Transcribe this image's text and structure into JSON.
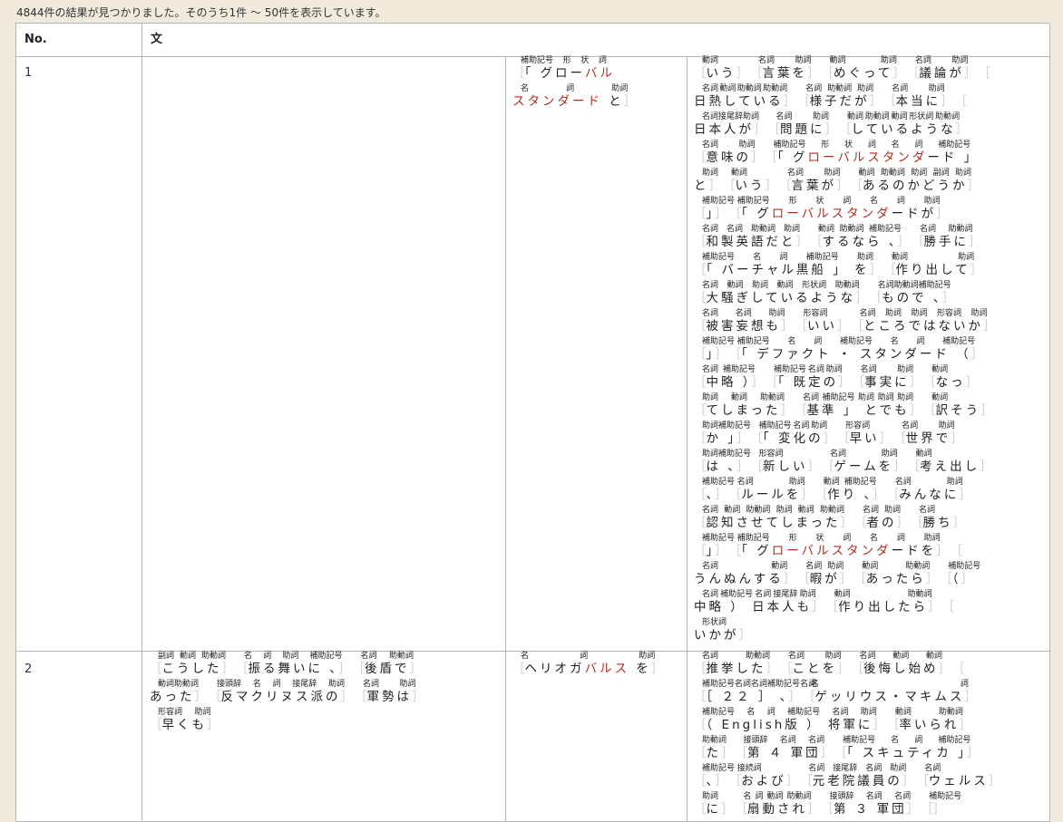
{
  "summary": "4844件の結果が見つかりました。そのうち1件 〜 50件を表示しています。",
  "table": {
    "headers": {
      "no": "No.",
      "sentence": "文"
    },
    "rows": [
      {
        "no": "1",
        "left": [],
        "keyword": [
          [
            {
              "pos": "補助記号 形 状 詞",
              "parts": [
                {
                  "t": "「 グロー"
                },
                {
                  "t": "バル",
                  "kw": true
                }
              ],
              "open": true,
              "close": false
            }
          ],
          [
            {
              "pos": "名 詞 助詞",
              "parts": [
                {
                  "t": "スタンダード",
                  "kw": true
                },
                {
                  "t": " と"
                }
              ],
              "open": false,
              "close": true
            }
          ]
        ],
        "right": [
          [
            {
              "pos": "動詞",
              "text": "いう"
            },
            {
              "pos": "名詞 助詞",
              "text": "言葉を"
            },
            {
              "pos": "動詞 助詞",
              "text": "めぐって"
            },
            {
              "pos": "名詞 助詞",
              "text": "議論が"
            },
            {
              "pos": "",
              "text": "",
              "open": true,
              "close": false
            }
          ],
          [
            {
              "pos": "名詞 動詞 助動詞 助動詞",
              "text": "日熱している",
              "open": false
            },
            {
              "pos": "名詞 助動詞 助詞",
              "text": "様子だが"
            },
            {
              "pos": "名詞 助詞",
              "text": "本当に"
            },
            {
              "pos": "",
              "text": "",
              "open": true,
              "close": false
            }
          ],
          [
            {
              "pos": "名詞 接尾辞 助詞",
              "text": "日本人が",
              "open": false
            },
            {
              "pos": "名詞 助詞",
              "text": "問題に"
            },
            {
              "pos": "動詞 助動詞 動詞 形状詞 助動詞",
              "text": "しているような"
            }
          ],
          [
            {
              "pos": "名詞 助詞",
              "text": "意味の"
            },
            {
              "pos": "補助記号 形 状 詞 名 詞 補助記号",
              "text": "「 グローバルスタンダード 」",
              "kwrange": [
                3,
                11
              ],
              "close": false
            }
          ],
          [
            {
              "pos": "助詞",
              "text": "と",
              "open": false
            },
            {
              "pos": "動詞",
              "text": "いう"
            },
            {
              "pos": "名詞 助詞",
              "text": "言葉が"
            },
            {
              "pos": "動詞 助動詞 助詞 副詞 助詞",
              "text": "あるのかどうか"
            }
          ],
          [
            {
              "pos": "補助記号",
              "text": "」"
            },
            {
              "pos": "補助記号 形 状 詞 名 詞 助詞",
              "text": "「 グローバルスタンダードが",
              "kwrange": [
                3,
                11
              ],
              "close": true
            }
          ],
          [
            {
              "pos": "名詞 名詞 助動詞 助詞",
              "text": "和製英語だと"
            },
            {
              "pos": "動詞 助動詞 補助記号",
              "text": "するなら 、"
            },
            {
              "pos": "名詞 助動詞",
              "text": "勝手に"
            }
          ],
          [
            {
              "pos": "補助記号 名 詞 補助記号 助詞",
              "text": "「 バーチャル黒船 」 を"
            },
            {
              "pos": "動詞 助詞",
              "text": "作り出して"
            }
          ],
          [
            {
              "pos": "名詞 動詞 助詞 動詞 形状詞 助動詞",
              "text": "大騒ぎしているような"
            },
            {
              "pos": "名詞 助動詞 補助記号",
              "text": "もので 、"
            }
          ],
          [
            {
              "pos": "名詞 名詞 助詞",
              "text": "被害妄想も"
            },
            {
              "pos": "形容詞",
              "text": "いい"
            },
            {
              "pos": "名詞 助詞 助詞 形容詞 助詞",
              "text": "ところではないか"
            }
          ],
          [
            {
              "pos": "補助記号",
              "text": "」"
            },
            {
              "pos": "補助記号 名 詞 補助記号 名 詞 補助記号",
              "text": "「 デファクト ・ スタンダード （"
            }
          ],
          [
            {
              "pos": "名詞 補助記号",
              "text": "中略 ）"
            },
            {
              "pos": "補助記号 名詞 助詞",
              "text": "「 既定の"
            },
            {
              "pos": "名詞 助詞",
              "text": "事実に"
            },
            {
              "pos": "動詞",
              "text": "なっ"
            }
          ],
          [
            {
              "pos": "助詞 動詞 助動詞",
              "text": "てしまった"
            },
            {
              "pos": "名詞 補助記号 助詞 助詞 助詞",
              "text": "基準 」 とでも"
            },
            {
              "pos": "動詞",
              "text": "訳そう"
            }
          ],
          [
            {
              "pos": "助詞 補助記号",
              "text": "か 」"
            },
            {
              "pos": "補助記号 名詞 助詞",
              "text": "「 変化の"
            },
            {
              "pos": "形容詞",
              "text": "早い"
            },
            {
              "pos": "名詞 助詞",
              "text": "世界で"
            }
          ],
          [
            {
              "pos": "助詞 補助記号",
              "text": "は 、"
            },
            {
              "pos": "形容詞",
              "text": "新しい"
            },
            {
              "pos": "名詞 助詞",
              "text": "ゲームを"
            },
            {
              "pos": "動詞",
              "text": "考え出し"
            }
          ],
          [
            {
              "pos": "補助記号",
              "text": "、"
            },
            {
              "pos": "名詞 助詞",
              "text": "ルールを"
            },
            {
              "pos": "動詞 補助記号",
              "text": "作り 、"
            },
            {
              "pos": "名詞 助詞",
              "text": "みんなに"
            }
          ],
          [
            {
              "pos": "名詞 動詞 助動詞 助詞 動詞 助動詞",
              "text": "認知させてしまった"
            },
            {
              "pos": "名詞 助詞",
              "text": "者の"
            },
            {
              "pos": "名詞",
              "text": "勝ち"
            }
          ],
          [
            {
              "pos": "補助記号",
              "text": "」"
            },
            {
              "pos": "補助記号 形 状 詞 名 詞 助詞",
              "text": "「 グローバルスタンダードを",
              "kwrange": [
                3,
                11
              ]
            },
            {
              "pos": "",
              "text": "",
              "open": true,
              "close": false
            }
          ],
          [
            {
              "pos": "名詞 動詞",
              "text": "うんぬんする",
              "open": false
            },
            {
              "pos": "名詞 助詞",
              "text": "暇が"
            },
            {
              "pos": "動詞 助動詞",
              "text": "あったら"
            },
            {
              "pos": "補助記号",
              "text": "（"
            }
          ],
          [
            {
              "pos": "名詞 補助記号 名詞 接尾辞 助詞",
              "text": "中略 ） 日本人も",
              "open": false
            },
            {
              "pos": "動詞 助動詞",
              "text": "作り出したら"
            },
            {
              "pos": "",
              "text": "",
              "open": true,
              "close": false
            }
          ],
          [
            {
              "pos": "形状詞",
              "text": "いかが",
              "open": false
            }
          ]
        ]
      },
      {
        "no": "2",
        "left": [
          [
            {
              "pos": "副詞 動詞 助動詞",
              "text": "こうした"
            },
            {
              "pos": "名 詞 助詞 補助記号",
              "text": "振る舞いに 、"
            },
            {
              "pos": "名詞 助動詞",
              "text": "後盾で"
            }
          ],
          [
            {
              "pos": "動詞 助動詞",
              "text": "あった",
              "open": false
            },
            {
              "pos": "接頭辞 名 詞 接尾辞 助詞",
              "text": "反マクリヌス派の"
            },
            {
              "pos": "名詞 助詞",
              "text": "軍勢は"
            }
          ],
          [
            {
              "pos": "形容詞 助詞",
              "text": "早くも"
            }
          ]
        ],
        "keyword": [
          [
            {
              "pos": "名 詞 助詞",
              "parts": [
                {
                  "t": "ヘリオガ"
                },
                {
                  "t": "バルス",
                  "kw": true
                },
                {
                  "t": " を"
                }
              ],
              "open": true,
              "close": true
            }
          ]
        ],
        "right": [
          [
            {
              "pos": "名詞 助動詞",
              "text": "推挙した"
            },
            {
              "pos": "名詞 助詞",
              "text": "ことを"
            },
            {
              "pos": "名詞 動詞 動詞",
              "text": "後悔し始め"
            },
            {
              "pos": "",
              "text": "",
              "open": true,
              "close": false
            }
          ],
          [
            {
              "pos": "補助記号 名詞 名詞 補助記号 名 詞",
              "text": "［ ２２ ］ 、"
            },
            {
              "pos": "名 詞",
              "text": "ゲッリウス・マキムス"
            }
          ],
          [
            {
              "pos": "補助記号 名 詞 補助記号 名詞 助詞",
              "text": "（ English版 ） 将軍に"
            },
            {
              "pos": "動詞 助動詞",
              "text": "率いられ"
            }
          ],
          [
            {
              "pos": "助動詞",
              "text": "た"
            },
            {
              "pos": "接頭辞 名詞 名詞",
              "text": "第 ４ 軍団"
            },
            {
              "pos": "補助記号 名 詞 補助記号",
              "text": "「 スキュティカ 」"
            }
          ],
          [
            {
              "pos": "補助記号",
              "text": "、"
            },
            {
              "pos": "接続詞",
              "text": "および"
            },
            {
              "pos": "名詞 接尾辞 名詞 助詞",
              "text": "元老院議員の"
            },
            {
              "pos": "名詞",
              "text": "ウェルス"
            }
          ],
          [
            {
              "pos": "助詞",
              "text": "に"
            },
            {
              "pos": "名 詞 動詞 助動詞",
              "text": "扇動され"
            },
            {
              "pos": "接頭辞 名詞 名詞",
              "text": "第 ３ 軍団"
            },
            {
              "pos": "補助記号",
              "text": ""
            }
          ]
        ]
      }
    ]
  },
  "colors": {
    "background": "#f1ebdd",
    "grid": "#b5b5b5",
    "keyword": "#b03020",
    "bracket": "#c9c9c9"
  }
}
